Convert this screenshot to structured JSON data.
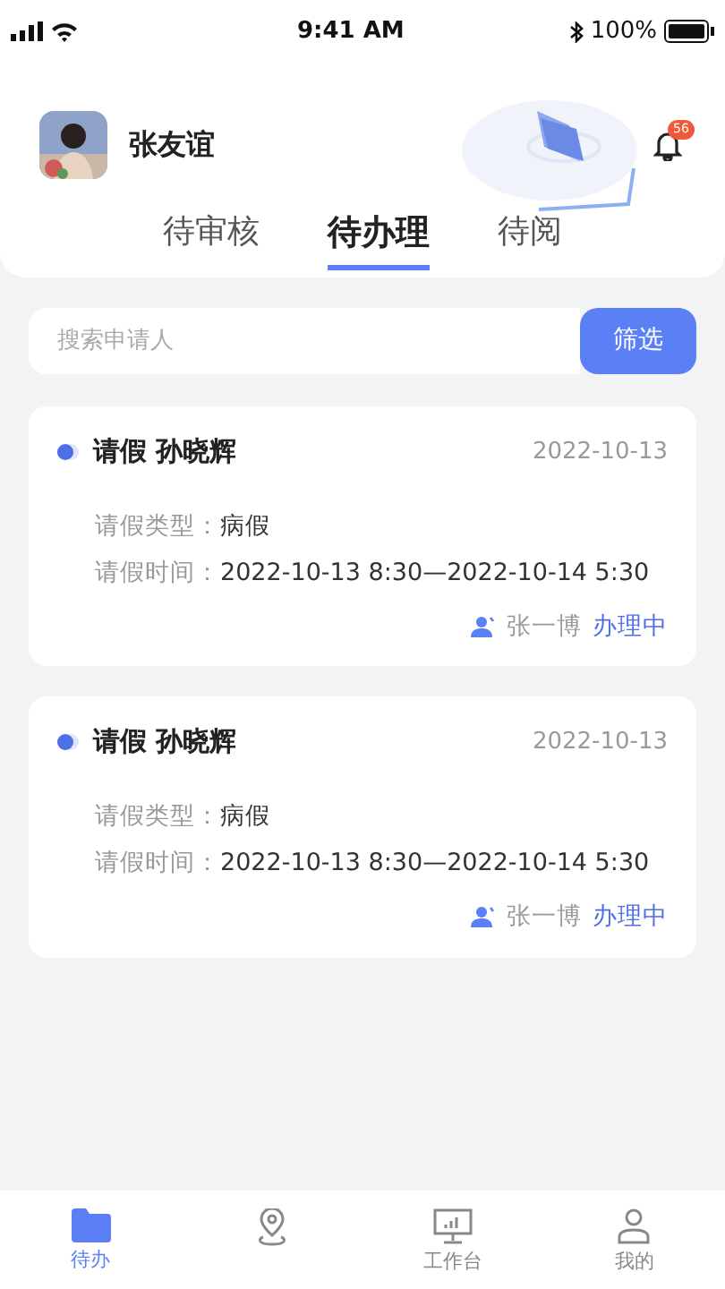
{
  "status_bar": {
    "time": "9:41 AM",
    "battery": "100%"
  },
  "header": {
    "user_name": "张友谊",
    "notification_count": "56"
  },
  "tabs": [
    {
      "label": "待审核",
      "selected": false
    },
    {
      "label": "待办理",
      "selected": true
    },
    {
      "label": "待阅",
      "selected": false
    }
  ],
  "search": {
    "placeholder": "搜索申请人",
    "button": "筛选"
  },
  "cards": [
    {
      "title": "请假 孙晓辉",
      "date": "2022-10-13",
      "fields": [
        {
          "label": "请假类型：",
          "value": "病假"
        },
        {
          "label": "请假时间：",
          "value": "2022-10-13 8:30—2022-10-14 5:30"
        }
      ],
      "handler": "张一博",
      "status": "办理中"
    },
    {
      "title": "请假 孙晓辉",
      "date": "2022-10-13",
      "fields": [
        {
          "label": "请假类型：",
          "value": "病假"
        },
        {
          "label": "请假时间：",
          "value": "2022-10-13 8:30—2022-10-14 5:30"
        }
      ],
      "handler": "张一博",
      "status": "办理中"
    }
  ],
  "bottom_nav": [
    {
      "kind": "folder",
      "label": "待办",
      "selected": true
    },
    {
      "kind": "pin",
      "selected": false
    },
    {
      "kind": "monitor",
      "label": "工作台",
      "selected": false
    },
    {
      "kind": "user",
      "label": "我的",
      "selected": false
    }
  ]
}
